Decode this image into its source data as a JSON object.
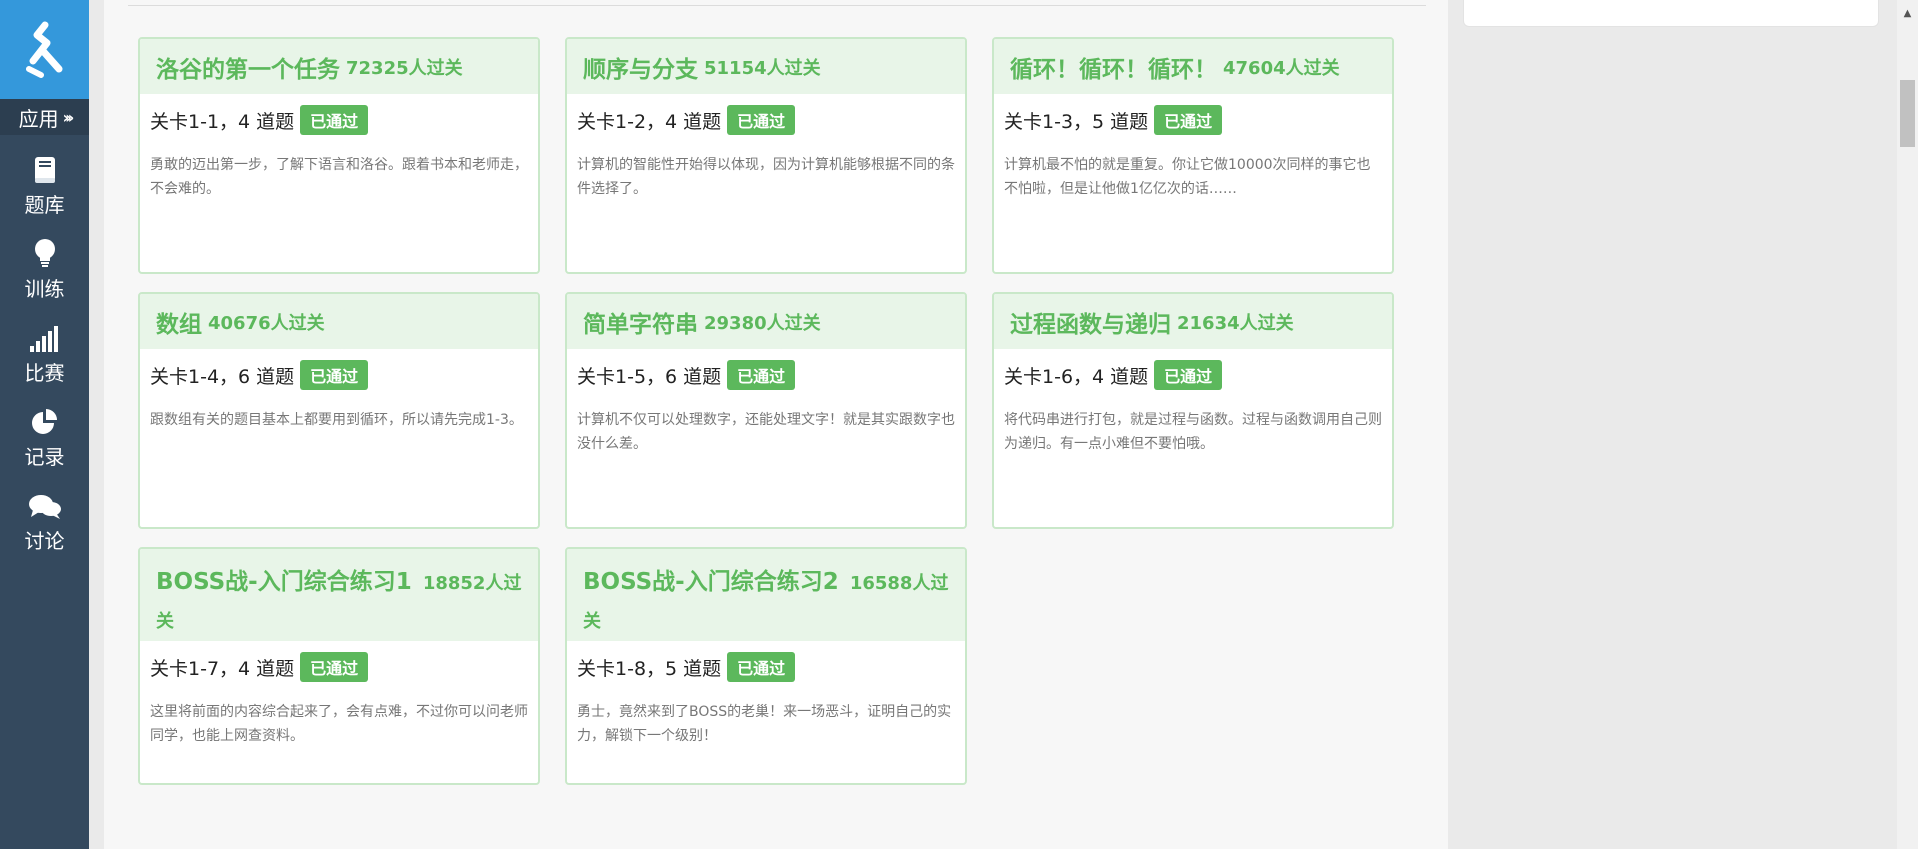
{
  "sidebar": {
    "app_label": "应用",
    "items": [
      {
        "label": "题库",
        "icon": "book-icon"
      },
      {
        "label": "训练",
        "icon": "lightbulb-icon"
      },
      {
        "label": "比赛",
        "icon": "signal-bars-icon"
      },
      {
        "label": "记录",
        "icon": "pie-chart-icon"
      },
      {
        "label": "讨论",
        "icon": "comments-icon"
      }
    ]
  },
  "colors": {
    "sidebar": "#34495e",
    "logo_bg": "#3498db",
    "accent_green": "#5cb85c",
    "card_head": "#e8f5e8"
  },
  "cards": [
    {
      "title": "洛谷的第一个任务",
      "passed": "72325人过关",
      "level": "关卡1-1，4 道题",
      "badge": "已通过",
      "desc": "勇敢的迈出第一步，了解下语言和洛谷。跟着书本和老师走，不会难的。"
    },
    {
      "title": "顺序与分支",
      "passed": "51154人过关",
      "level": "关卡1-2，4 道题",
      "badge": "已通过",
      "desc": "计算机的智能性开始得以体现，因为计算机能够根据不同的条件选择了。"
    },
    {
      "title": "循环！循环！循环！",
      "passed": "47604人过关",
      "level": "关卡1-3，5 道题",
      "badge": "已通过",
      "desc": "计算机最不怕的就是重复。你让它做10000次同样的事它也不怕啦，但是让他做1亿亿次的话……"
    },
    {
      "title": "数组",
      "passed": "40676人过关",
      "level": "关卡1-4，6 道题",
      "badge": "已通过",
      "desc": "跟数组有关的题目基本上都要用到循环，所以请先完成1-3。"
    },
    {
      "title": "简单字符串",
      "passed": "29380人过关",
      "level": "关卡1-5，6 道题",
      "badge": "已通过",
      "desc": "计算机不仅可以处理数字，还能处理文字！就是其实跟数字也没什么差。"
    },
    {
      "title": "过程函数与递归",
      "passed": "21634人过关",
      "level": "关卡1-6，4 道题",
      "badge": "已通过",
      "desc": "将代码串进行打包，就是过程与函数。过程与函数调用自己则为递归。有一点小难但不要怕哦。"
    },
    {
      "title": "BOSS战-入门综合练习1",
      "passed": "18852人过关",
      "level": "关卡1-7，4 道题",
      "badge": "已通过",
      "desc": "这里将前面的内容综合起来了，会有点难，不过你可以问老师同学，也能上网查资料。"
    },
    {
      "title": "BOSS战-入门综合练习2",
      "passed": "16588人过关",
      "level": "关卡1-8，5 道题",
      "badge": "已通过",
      "desc": "勇士，竟然来到了BOSS的老巢！来一场恶斗，证明自己的实力，解锁下一个级别！"
    }
  ]
}
